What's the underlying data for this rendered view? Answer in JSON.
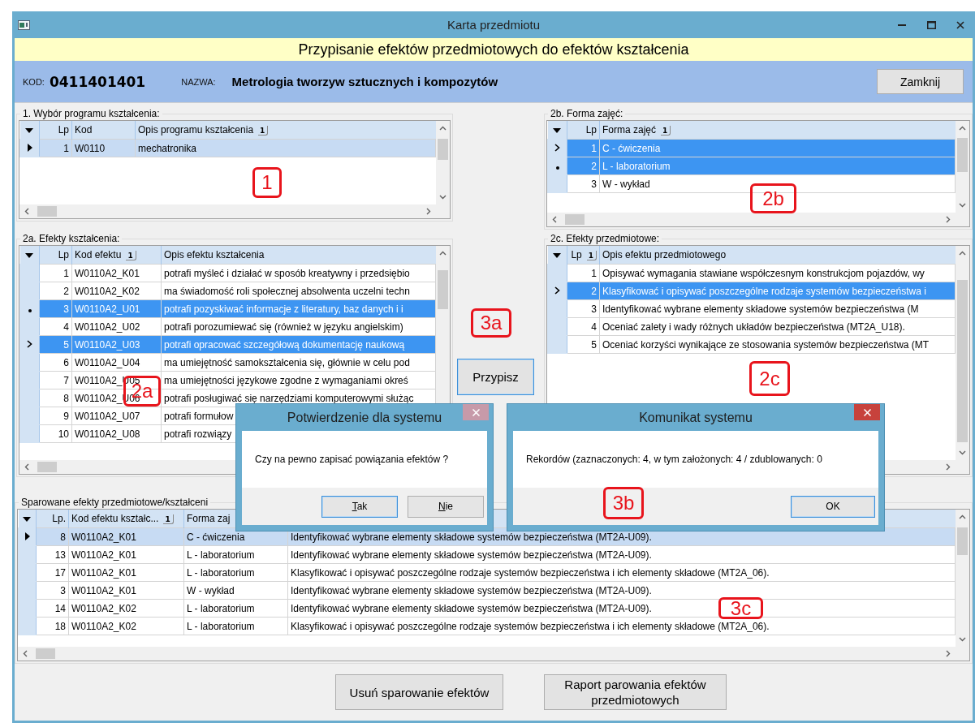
{
  "window": {
    "title": "Karta przedmiotu"
  },
  "header": {
    "title": "Przypisanie efektów przedmiotowych do efektów kształcenia",
    "code_label": "KOD:",
    "code": "0411401401",
    "name_label": "NAZWA:",
    "name": "Metrologia tworzyw sztucznych i kompozytów",
    "close_button": "Zamknij"
  },
  "grids": [
    {
      "label": "1. Wybór programu kształcenia:",
      "active": false,
      "columns": [
        {
          "title": "Lp"
        },
        {
          "title": "Kod"
        },
        {
          "title": "Opis programu kształcenia",
          "sort": "1"
        }
      ],
      "rows": [
        {
          "cells": [
            "1",
            "W0110",
            "mechatronika"
          ],
          "selected": true,
          "current": true
        }
      ]
    },
    {
      "label": "2b. Forma zajęć:",
      "active": true,
      "columns": [
        {
          "title": "Lp"
        },
        {
          "title": "Forma zajęć",
          "sort": "1"
        }
      ],
      "rows": [
        {
          "cells": [
            "1",
            "C - ćwiczenia"
          ],
          "selected": true,
          "current": true
        },
        {
          "cells": [
            "2",
            "L - laboratorium"
          ],
          "selected": true,
          "current": false
        },
        {
          "cells": [
            "3",
            "W - wykład"
          ],
          "selected": false,
          "current": false
        }
      ]
    },
    {
      "label": "2a. Efekty kształcenia:",
      "active": true,
      "columns": [
        {
          "title": "Lp"
        },
        {
          "title": "Kod efektu",
          "sort": "1"
        },
        {
          "title": "Opis efektu kształcenia"
        }
      ],
      "rows": [
        {
          "cells": [
            "1",
            "W0110A2_K01",
            "potrafi myśleć i działać w sposób kreatywny i przedsiębio"
          ],
          "selected": false,
          "current": false
        },
        {
          "cells": [
            "2",
            "W0110A2_K02",
            "ma świadomość roli społecznej absolwenta uczelni techn"
          ],
          "selected": false,
          "current": false
        },
        {
          "cells": [
            "3",
            "W0110A2_U01",
            "potrafi pozyskiwać informacje z literatury, baz danych i i"
          ],
          "selected": true,
          "current": false
        },
        {
          "cells": [
            "4",
            "W0110A2_U02",
            "potrafi porozumiewać się (również w języku angielskim)"
          ],
          "selected": false,
          "current": false
        },
        {
          "cells": [
            "5",
            "W0110A2_U03",
            "potrafi opracować szczegółową dokumentację naukową"
          ],
          "selected": true,
          "current": true
        },
        {
          "cells": [
            "6",
            "W0110A2_U04",
            "ma umiejętność samokształcenia się, głównie w celu pod"
          ],
          "selected": false,
          "current": false
        },
        {
          "cells": [
            "7",
            "W0110A2_U05",
            "ma umiejętności językowe zgodne z wymaganiami okreś"
          ],
          "selected": false,
          "current": false
        },
        {
          "cells": [
            "8",
            "W0110A2_U06",
            "potrafi posługiwać się narzędziami komputerowymi służąc"
          ],
          "selected": false,
          "current": false
        },
        {
          "cells": [
            "9",
            "W0110A2_U07",
            "potrafi formułow"
          ],
          "selected": false,
          "current": false
        },
        {
          "cells": [
            "10",
            "W0110A2_U08",
            "potrafi rozwiązy"
          ],
          "selected": false,
          "current": false
        }
      ]
    },
    {
      "label": "2c. Efekty przedmiotowe:",
      "active": true,
      "columns": [
        {
          "title": "Lp",
          "sort": "1"
        },
        {
          "title": "Opis efektu przedmiotowego"
        }
      ],
      "rows": [
        {
          "cells": [
            "1",
            "Opisywać wymagania stawiane współczesnym konstrukcjom pojazdów, wy"
          ],
          "selected": false,
          "current": false
        },
        {
          "cells": [
            "2",
            "Klasyfikować i opisywać poszczególne rodzaje systemów bezpieczeństwa i"
          ],
          "selected": true,
          "current": true
        },
        {
          "cells": [
            "3",
            "Identyfikować wybrane elementy składowe systemów bezpieczeństwa (M"
          ],
          "selected": false,
          "current": false
        },
        {
          "cells": [
            "4",
            "Oceniać zalety i wady różnych układów bezpieczeństwa (MT2A_U18)."
          ],
          "selected": false,
          "current": false
        },
        {
          "cells": [
            "5",
            "Oceniać korzyści wynikające ze stosowania systemów bezpieczeństwa (MT"
          ],
          "selected": false,
          "current": false
        }
      ]
    },
    {
      "label": "Sparowane efekty przedmiotowe/kształceni",
      "active": false,
      "columns": [
        {
          "title": "Lp."
        },
        {
          "title": "Kod efektu kształc...",
          "sort": "1"
        },
        {
          "title": "Forma zaj"
        }
      ],
      "rows": [
        {
          "cells": [
            "8",
            "W0110A2_K01",
            "C - ćwiczenia",
            "Identyfikować wybrane elementy składowe systemów bezpieczeństwa (MT2A-U09)."
          ],
          "selected": true,
          "current": true
        },
        {
          "cells": [
            "13",
            "W0110A2_K01",
            "L - laboratorium",
            "Identyfikować wybrane elementy składowe systemów bezpieczeństwa (MT2A-U09)."
          ],
          "selected": false,
          "current": false
        },
        {
          "cells": [
            "17",
            "W0110A2_K01",
            "L - laboratorium",
            "Klasyfikować i opisywać poszczególne rodzaje systemów bezpieczeństwa i ich elementy składowe (MT2A_06)."
          ],
          "selected": false,
          "current": false
        },
        {
          "cells": [
            "3",
            "W0110A2_K01",
            "W - wykład",
            "Identyfikować wybrane elementy składowe systemów bezpieczeństwa (MT2A-U09)."
          ],
          "selected": false,
          "current": false
        },
        {
          "cells": [
            "14",
            "W0110A2_K02",
            "L - laboratorium",
            "Identyfikować wybrane elementy składowe systemów bezpieczeństwa (MT2A-U09)."
          ],
          "selected": false,
          "current": false
        },
        {
          "cells": [
            "18",
            "W0110A2_K02",
            "L - laboratorium",
            "Klasyfikować i opisywać poszczególne rodzaje systemów bezpieczeństwa i ich elementy składowe (MT2A_06)."
          ],
          "selected": false,
          "current": false
        }
      ]
    }
  ],
  "assign_button": "Przypisz",
  "bottom_buttons": [
    "Usuń sparowanie efektów",
    "Raport parowania efektów przedmiotowych"
  ],
  "dialogs": [
    {
      "title": "Potwierdzenie dla systemu",
      "active": false,
      "message": "Czy na pewno zapisać powiązania efektów ?",
      "buttons": [
        {
          "label": "Tak",
          "focused": true,
          "access_key": true
        },
        {
          "label": "Nie",
          "focused": false,
          "access_key": true
        }
      ]
    },
    {
      "title": "Komunikat systemu",
      "active": true,
      "message": "Rekordów (zaznaczonych: 4, w tym założonych: 4 / zdublowanych: 0",
      "buttons": [
        {
          "label": "OK",
          "focused": true,
          "access_key": false
        }
      ]
    }
  ],
  "annotations": [
    "1",
    "2a",
    "2b",
    "2c",
    "3a",
    "3b",
    "3c"
  ]
}
